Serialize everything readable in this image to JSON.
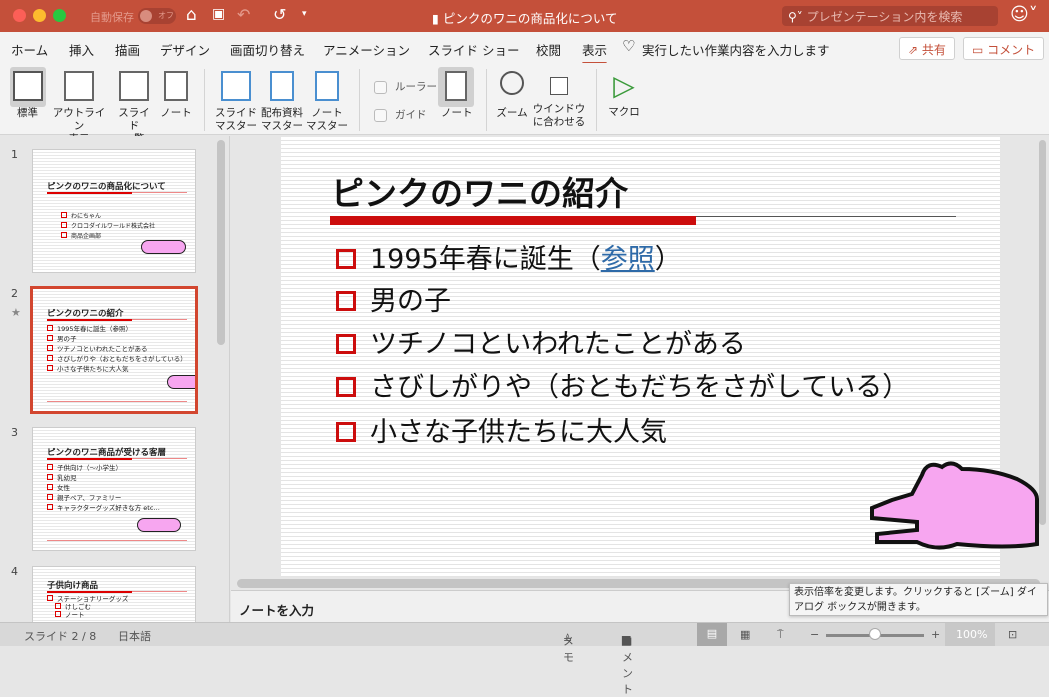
{
  "titlebar": {
    "autosave_label": "自動保存",
    "autosave_state": "オフ",
    "doc_title": "ピンクのワニの商品化について",
    "search_placeholder": "プレゼンテーション内を検索"
  },
  "tabs": [
    "ホーム",
    "挿入",
    "描画",
    "デザイン",
    "画面切り替え",
    "アニメーション",
    "スライド ショー",
    "校閲",
    "表示"
  ],
  "tell_me": "実行したい作業内容を入力します",
  "share_label": "共有",
  "comment_label": "コメント",
  "ribbon": {
    "normal": "標準",
    "outline": [
      "アウトライン",
      "表示"
    ],
    "sorter": [
      "スライド",
      "一覧"
    ],
    "notes_page": "ノート",
    "slide_master": [
      "スライド",
      "マスター"
    ],
    "handout_master": [
      "配布資料",
      "マスター"
    ],
    "notes_master": [
      "ノート",
      "マスター"
    ],
    "ruler": "ルーラー",
    "guides": "ガイド",
    "notes": "ノート",
    "zoom": "ズーム",
    "fit": [
      "ウインドウ",
      "に合わせる"
    ],
    "macro": "マクロ"
  },
  "thumbnails": [
    {
      "num": "1",
      "title": "ピンクのワニの商品化について",
      "lines": [
        "わにちゃん",
        "クロコダイルワールド株式会社",
        "商品企画部"
      ]
    },
    {
      "num": "2",
      "title": "ピンクのワニの紹介",
      "lines": [
        "1995年春に誕生（参照）",
        "男の子",
        "ツチノコといわれたことがある",
        "さびしがりや（おともだちをさがしている）",
        "小さな子供たちに大人気"
      ]
    },
    {
      "num": "3",
      "title": "ピンクのワニ商品が受ける客層",
      "lines": [
        "子供向け（～小学生）",
        "乳幼児",
        "女性",
        "親子ペア、ファミリー",
        "キャラクターグッズ好きな方 etc…"
      ]
    },
    {
      "num": "4",
      "title": "子供向け商品",
      "lines": [
        "ステーショナリーグッズ",
        "けしごむ",
        "ノート"
      ]
    }
  ],
  "slide": {
    "title": "ピンクのワニの紹介",
    "bullets": [
      {
        "pre": "1995年春に誕生（",
        "link": "参照",
        "post": "）"
      },
      {
        "text": "男の子"
      },
      {
        "text": "ツチノコといわれたことがある"
      },
      {
        "text": "さびしがりや（おともだちをさがしている）"
      },
      {
        "text": "小さな子供たちに大人気"
      }
    ]
  },
  "notes_placeholder": "ノートを入力",
  "tooltip": [
    "表示倍率を変更します。クリックすると [ズーム] ダイ",
    "アログ ボックスが開きます。"
  ],
  "status": {
    "slide_pos": "スライド 2 / 8",
    "language": "日本語",
    "notes": "メモ",
    "comments": "コメント",
    "zoom": "100%"
  }
}
